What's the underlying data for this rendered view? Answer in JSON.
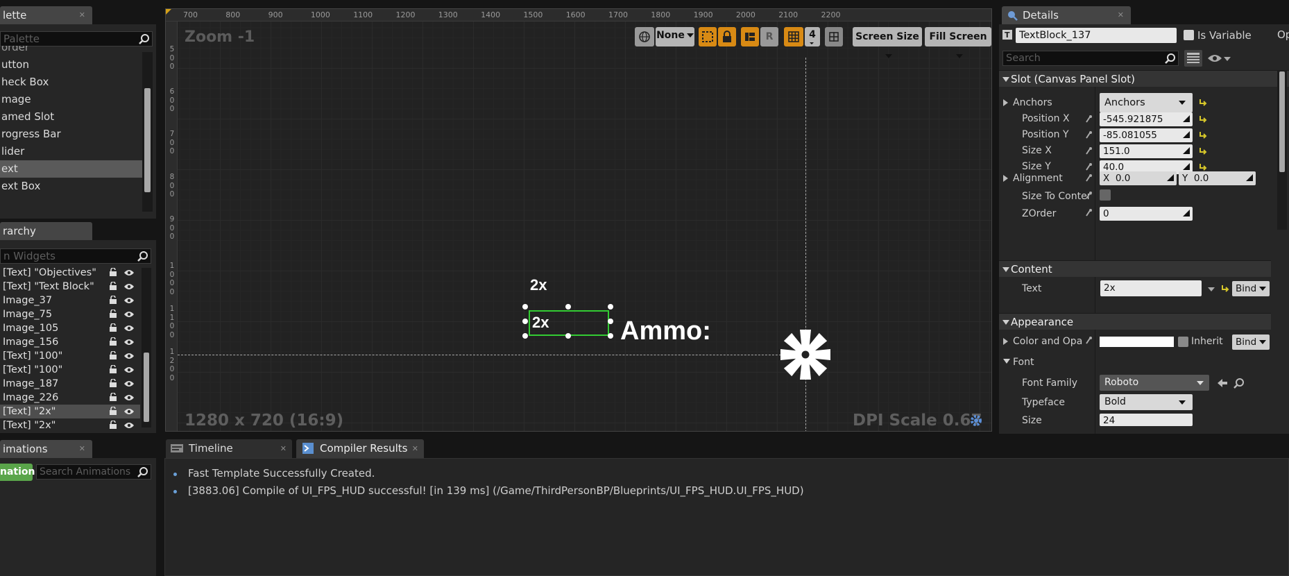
{
  "palette": {
    "tab": "lette",
    "search_placeholder": "Palette",
    "items": [
      "utton",
      "heck Box",
      "mage",
      "amed Slot",
      "rogress Bar",
      "lider",
      "ext",
      "ext Box"
    ],
    "selected_index": 6,
    "partial_top": "order"
  },
  "hierarchy": {
    "tab": "rarchy",
    "search_placeholder": "n Widgets",
    "items": [
      "[Text] \"Objectives\"",
      "[Text] \"Text Block\"",
      "Image_37",
      "Image_75",
      "Image_105",
      "Image_156",
      "[Text] \"100\"",
      "[Text] \"100\"",
      "Image_187",
      "Image_226",
      "[Text] \"2x\"",
      "[Text] \"2x\""
    ],
    "selected_index": 10
  },
  "animations": {
    "tab": "imations",
    "add_label": "nation",
    "search_placeholder": "Search Animations"
  },
  "designer": {
    "zoom": "Zoom -1",
    "resolution": "1280 x 720 (16:9)",
    "dpi": "DPI Scale 0.67",
    "ruler_x": [
      "700",
      "800",
      "900",
      "1000",
      "1100",
      "1200",
      "1300",
      "1400",
      "1500",
      "1600",
      "1700",
      "1800",
      "1900",
      "2000",
      "2100",
      "2200"
    ],
    "ruler_y": [
      [
        "5",
        "0",
        "0"
      ],
      [
        "6",
        "0",
        "0"
      ],
      [
        "7",
        "0",
        "0"
      ],
      [
        "8",
        "0",
        "0"
      ],
      [
        "9",
        "0",
        "0"
      ],
      [
        "1",
        "0",
        "0",
        "0"
      ],
      [
        "1",
        "1",
        "0",
        "0"
      ],
      [
        "1",
        "2",
        "0",
        "0"
      ]
    ],
    "toolbar": {
      "none_label": "None",
      "r_label": "R",
      "grid_value": "4",
      "screen_size": "Screen Size",
      "fill_screen": "Fill Screen"
    },
    "text_2x_top": "2x",
    "text_2x_selected": "2x",
    "ammo_text": "Ammo:"
  },
  "bottom": {
    "tabs": [
      "Timeline",
      "Compiler Results"
    ],
    "log": [
      "Fast Template Successfully Created.",
      "[3883.06] Compile of UI_FPS_HUD successful! [in 139 ms] (/Game/ThirdPersonBP/Blueprints/UI_FPS_HUD.UI_FPS_HUD)"
    ]
  },
  "details": {
    "tab": "Details",
    "name": "TextBlock_137",
    "is_variable": "Is Variable",
    "op": "Op",
    "search_placeholder": "Search",
    "slot_section": "Slot (Canvas Panel Slot)",
    "anchors_label": "Anchors",
    "anchors_value": "Anchors",
    "pos_x_label": "Position X",
    "pos_x": "-545.921875",
    "pos_y_label": "Position Y",
    "pos_y": "-85.081055",
    "size_x_label": "Size X",
    "size_x": "151.0",
    "size_y_label": "Size Y",
    "size_y": "40.0",
    "alignment_label": "Alignment",
    "align_x_label": "X",
    "align_x": "0.0",
    "align_y_label": "Y",
    "align_y": "0.0",
    "size_to_content_label": "Size To Content",
    "zorder_label": "ZOrder",
    "zorder": "0",
    "content_section": "Content",
    "text_label": "Text",
    "text_value": "2x",
    "bind": "Bind",
    "appearance_section": "Appearance",
    "color_label": "Color and Opa",
    "inherit": "Inherit",
    "font_label": "Font",
    "font_family_label": "Font Family",
    "font_family": "Roboto",
    "typeface_label": "Typeface",
    "typeface": "Bold",
    "size_label": "Size",
    "size": "24"
  }
}
